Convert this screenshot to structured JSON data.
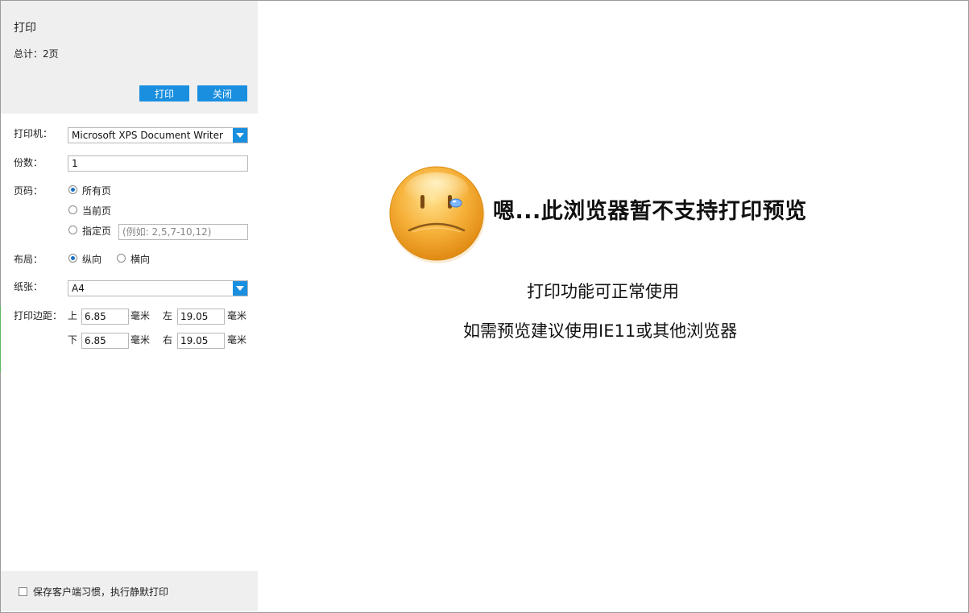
{
  "panel": {
    "title": "打印",
    "total": "总计：2页",
    "print_button": "打印",
    "close_button": "关闭"
  },
  "printer": {
    "label": "打印机：",
    "value": "Microsoft XPS Document Writer"
  },
  "copies": {
    "label": "份数：",
    "value": "1"
  },
  "pages": {
    "label": "页码：",
    "options": [
      "所有页",
      "当前页",
      "指定页"
    ],
    "selected": "所有页",
    "custom_placeholder": "(例如: 2,5,7-10,12)"
  },
  "layout": {
    "label": "布局：",
    "options": [
      "纵向",
      "横向"
    ],
    "selected": "纵向"
  },
  "paper": {
    "label": "纸张：",
    "value": "A4"
  },
  "margins": {
    "label": "打印边距：",
    "top_label": "上",
    "top_value": "6.85",
    "left_label": "左",
    "left_value": "19.05",
    "bottom_label": "下",
    "bottom_value": "6.85",
    "right_label": "右",
    "right_value": "19.05",
    "unit": "毫米"
  },
  "footer": {
    "checkbox_label": "保存客户端习惯，执行静默打印",
    "checked": false
  },
  "preview": {
    "main_message": "嗯...此浏览器暂不支持打印预览",
    "line1": "打印功能可正常使用",
    "line2": "如需预览建议使用IE11或其他浏览器",
    "face_icon": "sad-face-icon"
  },
  "colors": {
    "accent": "#1a8fe0",
    "panel_bg": "#efefef",
    "face": "#f4a21e"
  }
}
